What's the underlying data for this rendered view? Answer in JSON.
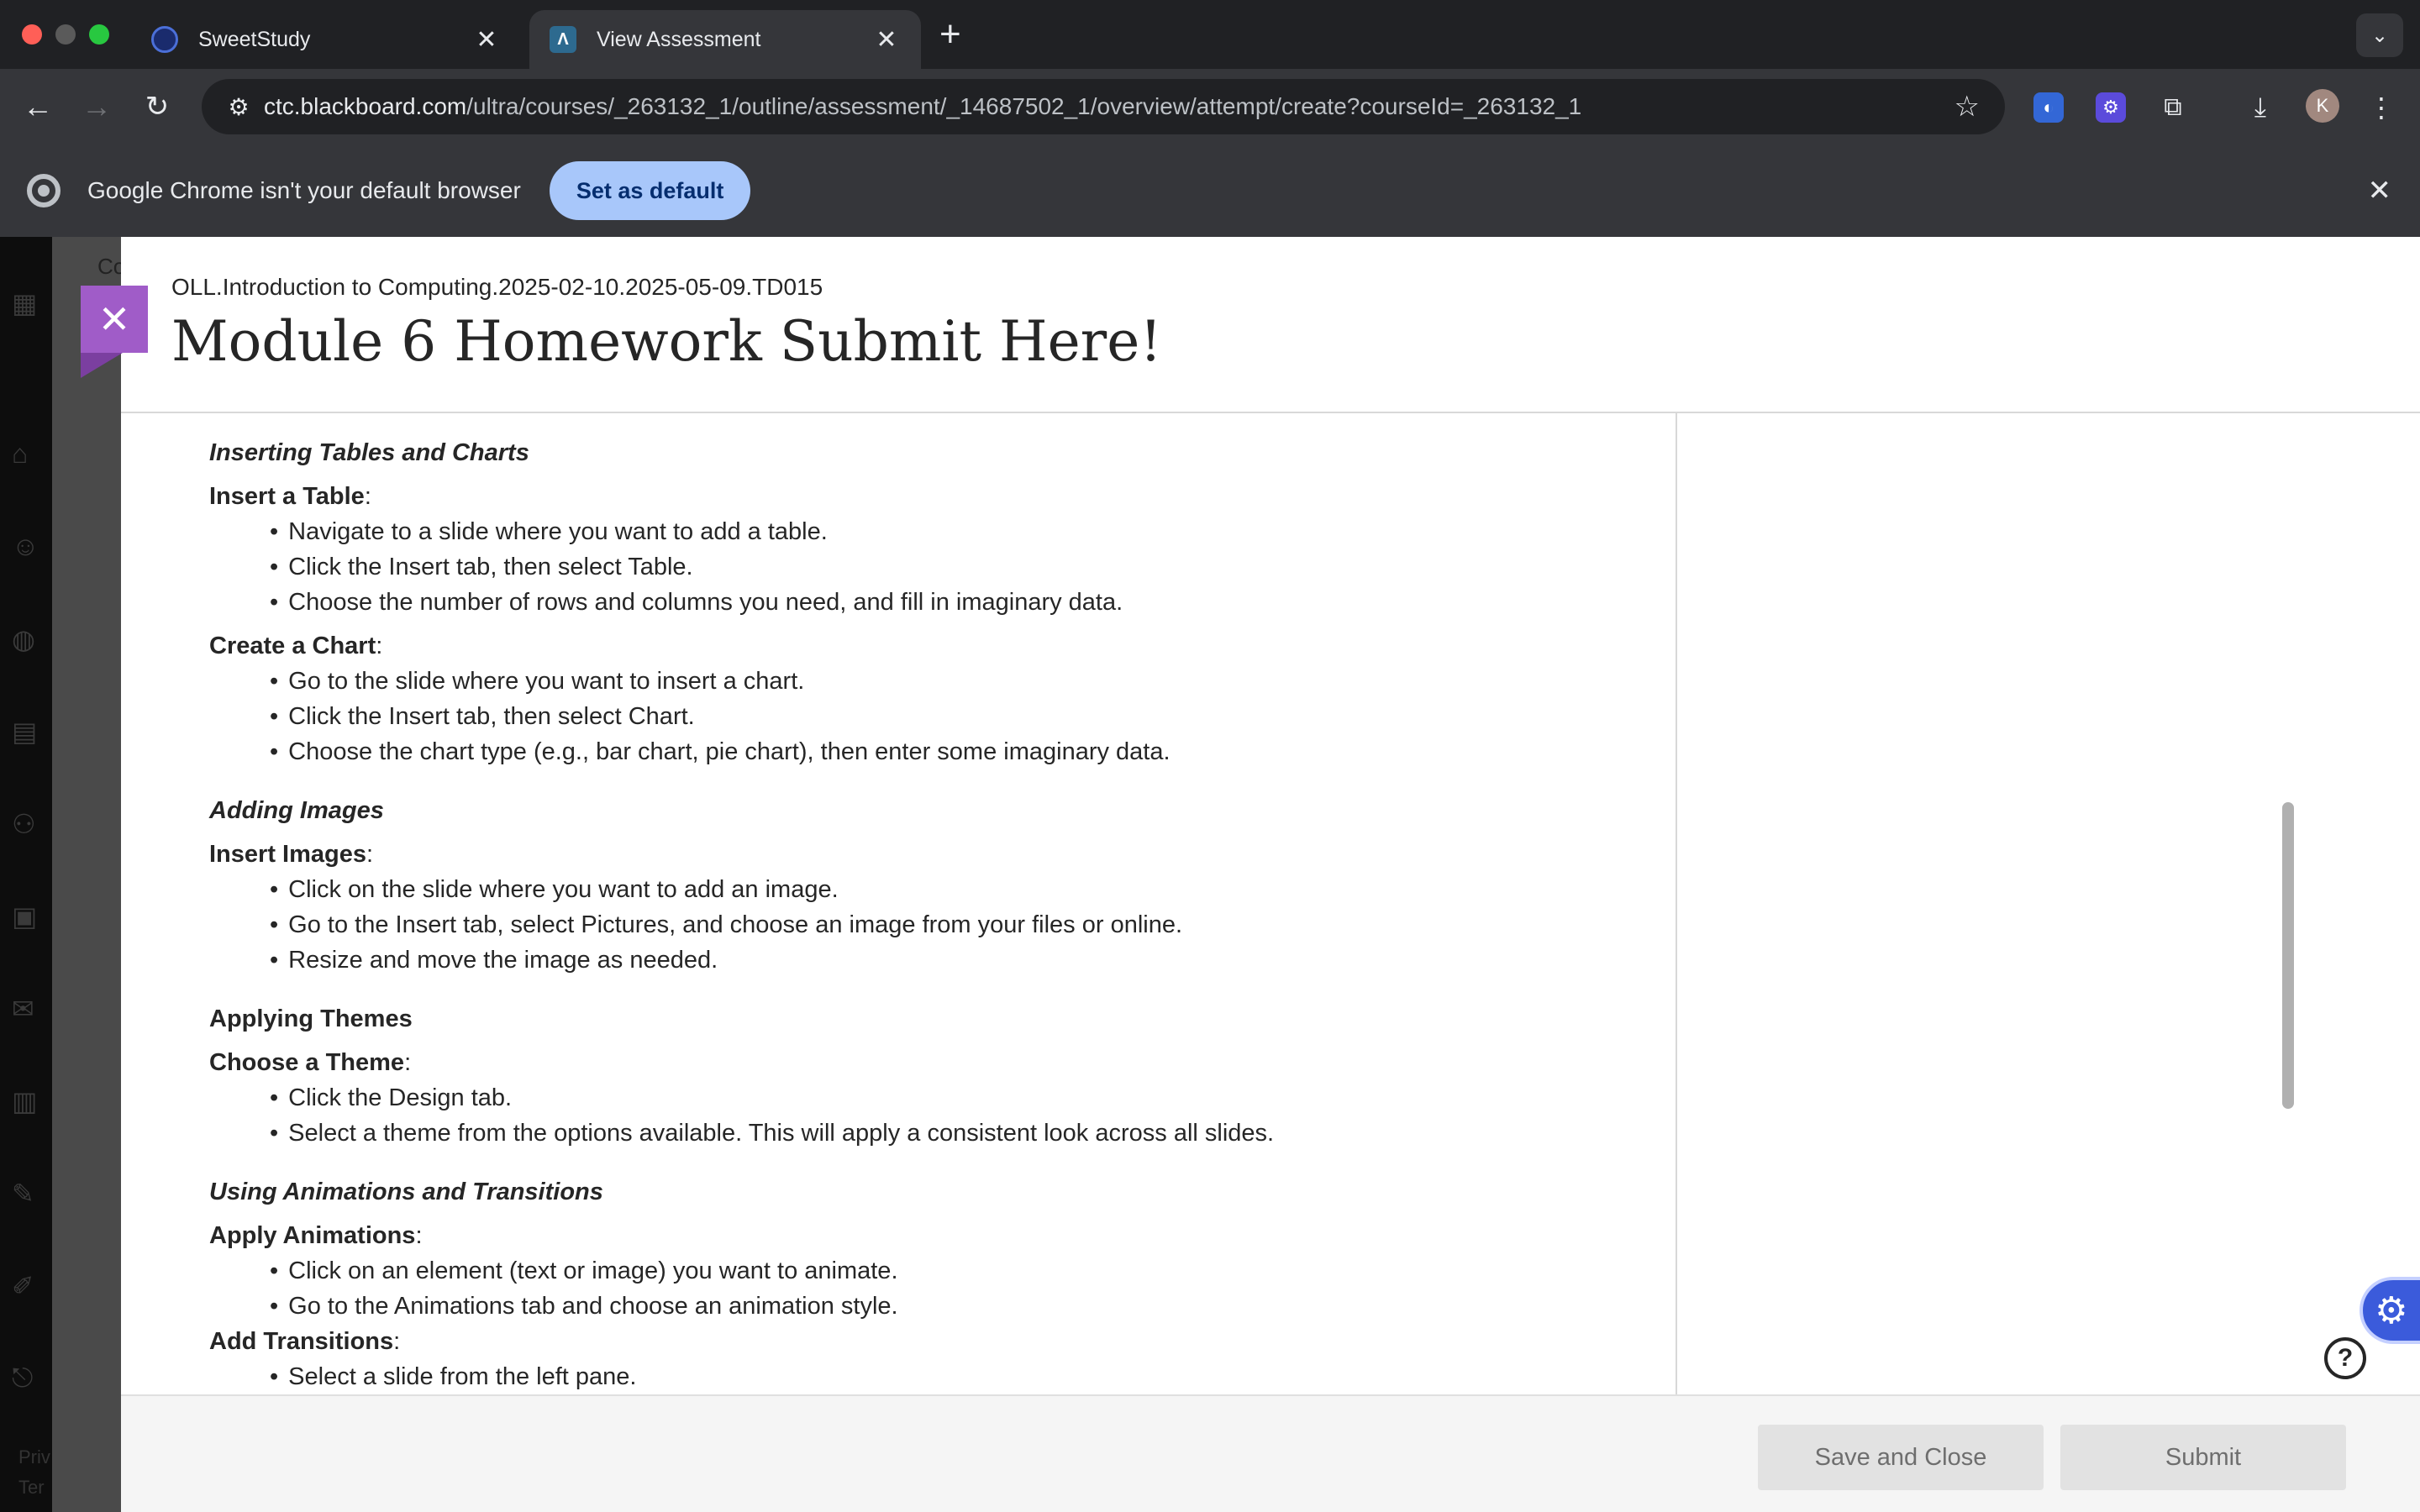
{
  "browser": {
    "tabs": [
      {
        "title": "SweetStudy",
        "active": false,
        "favicon_color": "#1a2b6d"
      },
      {
        "title": "View Assessment",
        "active": true,
        "favicon_color": "#2d6a8f"
      }
    ],
    "url_host": "ctc.blackboard.com",
    "url_path": "/ultra/courses/_263132_1/outline/assessment/_14687502_1/overview/attempt/create?courseId=_263132_1",
    "avatar_letter": "K"
  },
  "infobar": {
    "message": "Google Chrome isn't your default browser",
    "button": "Set as default"
  },
  "background": {
    "peek_text": "Co",
    "privacy_1": "Priv",
    "privacy_2": "Ter"
  },
  "panel": {
    "course": "OLL.Introduction to Computing.2025-02-10.2025-05-09.TD015",
    "title": "Module 6 Homework Submit Here!"
  },
  "content": {
    "s1": "Inserting Tables and Charts",
    "s1a_label": "Insert a Table",
    "s1a_items": [
      "Navigate to a slide where you want to add a table.",
      "Click the Insert tab, then select Table.",
      "Choose the number of rows and columns you need, and fill in imaginary data."
    ],
    "s1b_label": "Create a Chart",
    "s1b_items": [
      "Go to the slide where you want to insert a chart.",
      "Click the Insert tab, then select Chart.",
      "Choose the chart type (e.g., bar chart, pie chart), then enter some imaginary data."
    ],
    "s2": "Adding Images",
    "s2a_label": "Insert Images",
    "s2a_items": [
      "Click on the slide where you want to add an image.",
      "Go to the Insert tab, select Pictures, and choose an image from your files or online.",
      "Resize and move the image as needed."
    ],
    "s3": "Applying Themes",
    "s3a_label": "Choose a Theme",
    "s3a_items": [
      "Click the Design tab.",
      "Select a theme from the options available. This will apply a consistent look across all slides."
    ],
    "s4": "Using Animations and Transitions",
    "s4a_label": "Apply Animations",
    "s4a_items": [
      "Click on an element (text or image) you want to animate.",
      "Go to the Animations tab and choose an animation style."
    ],
    "s4b_label": "Add Transitions",
    "s4b_items": [
      "Select a slide from the left pane."
    ]
  },
  "footer": {
    "save_label": "Save and Close",
    "submit_label": "Submit"
  },
  "colors": {
    "close_accent": "#a05cc8",
    "gear_fab": "#3b5bdb"
  }
}
